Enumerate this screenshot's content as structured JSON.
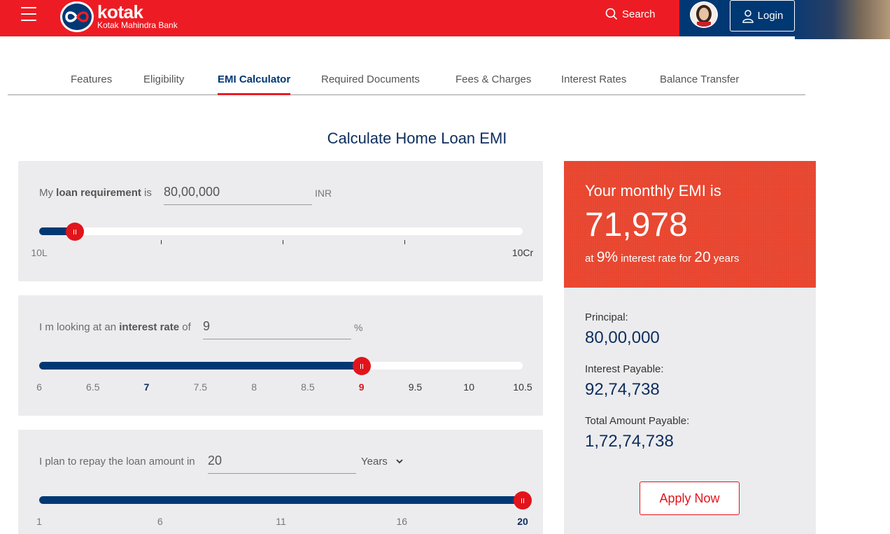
{
  "header": {
    "logo_name": "kotak",
    "logo_sub": "Kotak Mahindra Bank",
    "search_label": "Search",
    "login_label": "Login"
  },
  "tabs": [
    {
      "label": "Features"
    },
    {
      "label": "Eligibility"
    },
    {
      "label": "EMI Calculator",
      "active": true
    },
    {
      "label": "Required Documents"
    },
    {
      "label": "Fees & Charges"
    },
    {
      "label": "Interest Rates"
    },
    {
      "label": "Balance Transfer"
    }
  ],
  "section_title": "Calculate Home Loan EMI",
  "loan": {
    "label_pre": "My ",
    "label_bold": "loan requirement",
    "label_post": " is",
    "value": "80,00,000",
    "unit": "INR",
    "slider_fraction": 0.074,
    "min_label": "10L",
    "max_label": "10Cr"
  },
  "interest": {
    "label_pre": "I m looking at an ",
    "label_bold": "interest rate",
    "label_post": " of",
    "value": "9",
    "unit": "%",
    "slider_fraction": 0.667,
    "ticks": [
      "6",
      "6.5",
      "7",
      "7.5",
      "8",
      "8.5",
      "9",
      "9.5",
      "10",
      "10.5"
    ]
  },
  "tenure": {
    "label": "I plan to repay the loan amount in",
    "value": "20",
    "unit_select": "Years",
    "slider_fraction": 1.0,
    "ticks": [
      "1",
      "6",
      "11",
      "16",
      "20"
    ]
  },
  "result": {
    "heading": "Your monthly EMI is",
    "emi": "71,978",
    "sub_at": "at ",
    "rate": "9%",
    "sub_mid": " interest rate for ",
    "years": "20",
    "sub_end": " years",
    "principal_label": "Principal:",
    "principal_value": "80,00,000",
    "interest_label": "Interest Payable:",
    "interest_value": "92,74,738",
    "total_label": "Total Amount Payable:",
    "total_value": "1,72,74,738",
    "apply_label": "Apply Now"
  },
  "colors": {
    "brand_red": "#ed1c24",
    "brand_navy": "#003874",
    "result_orange": "#e8442e"
  }
}
